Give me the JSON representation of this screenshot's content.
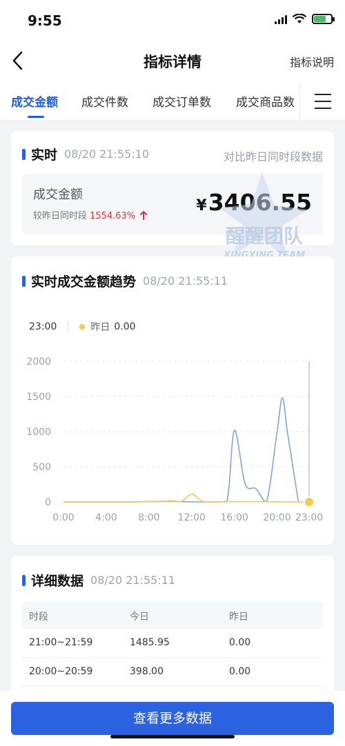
{
  "status_bar": {
    "time": "9:55"
  },
  "nav": {
    "back_icon": "chevron-left-icon",
    "title": "指标详情",
    "right_link": "指标说明"
  },
  "tabs": [
    {
      "label": "成交金额",
      "active": true
    },
    {
      "label": "成交件数",
      "active": false
    },
    {
      "label": "成交订单数",
      "active": false
    },
    {
      "label": "成交商品数",
      "active": false
    }
  ],
  "realtime": {
    "title": "实时",
    "timestamp": "08/20 21:55:10",
    "compare_link": "对比昨日同时段数据",
    "metric_name": "成交金额",
    "compare_label": "较昨日同时段",
    "compare_pct": "1554.63%",
    "currency": "¥",
    "value": "3406.55"
  },
  "watermark": {
    "text": "醒醒团队",
    "subtext": "XINGXING TEAM"
  },
  "trend": {
    "title": "实时成交金额趋势",
    "timestamp": "08/20 21:55:11",
    "tooltip_time": "23:00",
    "tooltip_series": "昨日",
    "tooltip_value": "0.00"
  },
  "chart_data": {
    "type": "line",
    "x": [
      0,
      1,
      2,
      3,
      4,
      5,
      6,
      7,
      8,
      9,
      10,
      11,
      12,
      13,
      14,
      15,
      16,
      17,
      18,
      19,
      20,
      21,
      22,
      23
    ],
    "xticks": [
      "0:00",
      "4:00",
      "8:00",
      "12:00",
      "16:00",
      "20:00",
      "23:00"
    ],
    "yticks": [
      "0",
      "500",
      "1000",
      "1500",
      "2000"
    ],
    "ylim": [
      0,
      2000
    ],
    "xlim": [
      0,
      23
    ],
    "grid": true,
    "series": [
      {
        "name": "今日",
        "color": "#7ea6dc",
        "points": [
          [
            0,
            0
          ],
          [
            6,
            0
          ],
          [
            8,
            5
          ],
          [
            10,
            10
          ],
          [
            12,
            0
          ],
          [
            14,
            0
          ],
          [
            15.3,
            10
          ],
          [
            16,
            1020
          ],
          [
            17,
            260
          ],
          [
            18,
            190
          ],
          [
            19,
            0
          ],
          [
            20,
            1000
          ],
          [
            20.5,
            1480
          ],
          [
            21,
            960
          ],
          [
            22,
            0
          ]
        ]
      },
      {
        "name": "昨日",
        "color": "#f3c94f",
        "points": [
          [
            0,
            0
          ],
          [
            6,
            0
          ],
          [
            7,
            2
          ],
          [
            8,
            8
          ],
          [
            9,
            4
          ],
          [
            10,
            15
          ],
          [
            11,
            5
          ],
          [
            12,
            110
          ],
          [
            13,
            10
          ],
          [
            14,
            0
          ],
          [
            15,
            2
          ],
          [
            16,
            5
          ],
          [
            18,
            4
          ],
          [
            20,
            2
          ],
          [
            23,
            0
          ]
        ]
      }
    ]
  },
  "detail": {
    "title": "详细数据",
    "timestamp": "08/20 21:55:11",
    "columns": [
      "时段",
      "今日",
      "昨日"
    ],
    "rows": [
      [
        "21:00~21:59",
        "1485.95",
        "0.00"
      ],
      [
        "20:00~20:59",
        "398.00",
        "0.00"
      ]
    ]
  },
  "footer": {
    "cta": "查看更多数据"
  }
}
